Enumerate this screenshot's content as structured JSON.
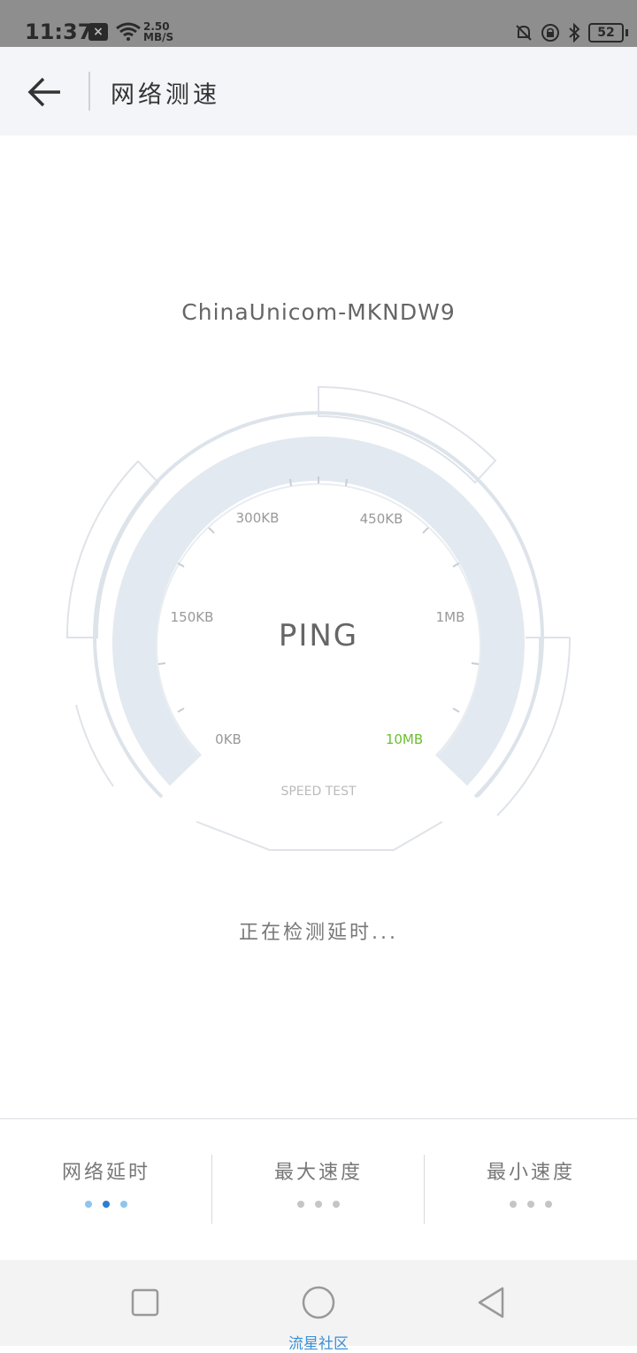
{
  "status_bar": {
    "time": "11:37",
    "notification": "×",
    "speed_value": "2.50",
    "speed_unit": "MB/S",
    "battery": "52"
  },
  "header": {
    "title": "网络测速"
  },
  "network_name": "ChinaUnicom-MKNDW9",
  "gauge": {
    "labels": [
      "0KB",
      "150KB",
      "300KB",
      "450KB",
      "1MB",
      "10MB"
    ],
    "highlight_label": "10MB",
    "highlight_color": "#6cbf2e",
    "bottom_label": "SPEED TEST",
    "center_label": "PING"
  },
  "status_message": "正在检测延时...",
  "stats": [
    {
      "label": "网络延时"
    },
    {
      "label": "最大速度"
    },
    {
      "label": "最小速度"
    }
  ],
  "nav": {
    "caption": "流星社区",
    "icons": [
      "recent-apps-icon",
      "home-icon",
      "back-icon"
    ]
  },
  "colors": {
    "accent": "#2a7fcf",
    "gauge_fill": "#e3e9f0",
    "highlight": "#6cbf2e"
  }
}
